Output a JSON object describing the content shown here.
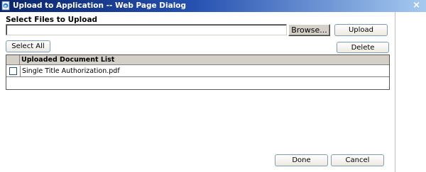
{
  "window": {
    "title": "Upload to Application -- Web Page Dialog",
    "close_glyph": "×"
  },
  "upload": {
    "section_title": "Select Files to Upload",
    "file_value": "",
    "browse_label": "Browse...",
    "upload_label": "Upload"
  },
  "actions": {
    "select_all_label": "Select All",
    "delete_label": "Delete"
  },
  "document_list": {
    "header": "Uploaded Document List",
    "rows": [
      {
        "checked": false,
        "name": "Single Title Authorization.pdf"
      }
    ]
  },
  "footer": {
    "done_label": "Done",
    "cancel_label": "Cancel"
  },
  "colors": {
    "titlebar_start": "#0a246a",
    "titlebar_end": "#a6caf0",
    "button_border": "#7f9db9",
    "table_header_bg": "#d4d0c8"
  },
  "icons": {
    "app_icon": "ie-page-icon",
    "close_icon": "close-icon"
  }
}
